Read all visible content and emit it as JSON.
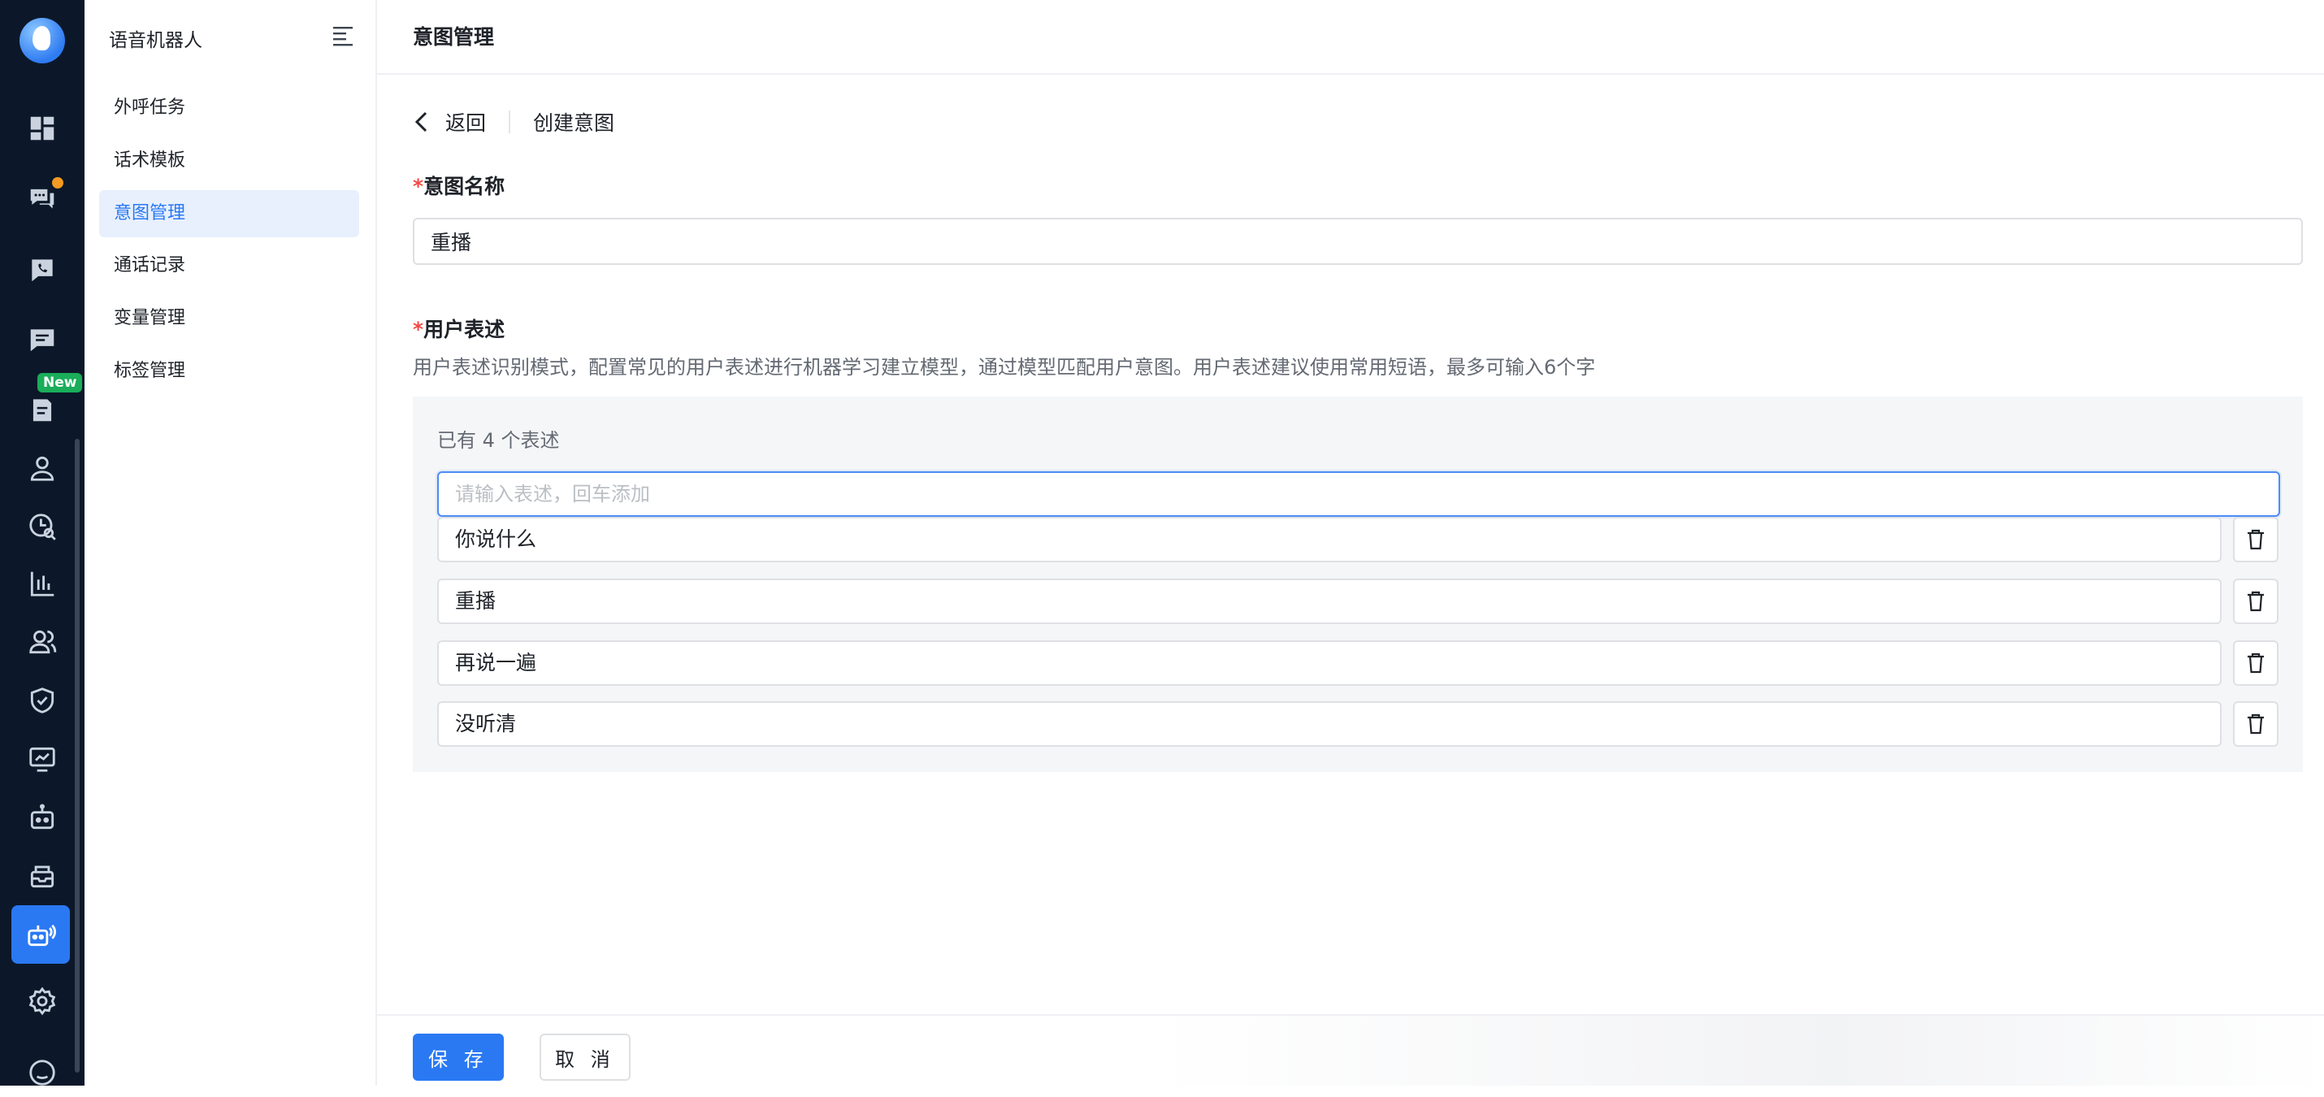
{
  "rail": {
    "icons": [
      "logo",
      "dashboard-icon",
      "chat-bubbles-icon",
      "phone-chat-icon",
      "message-icon",
      "document-icon",
      "user-icon",
      "clock-search-icon",
      "bar-chart-icon",
      "users-icon",
      "shield-check-icon",
      "monitor-chart-icon",
      "robot-icon",
      "inbox-icon",
      "voice-robot-icon",
      "settings-icon",
      "chat-circle-icon"
    ],
    "new_badge": "New",
    "notify_badge_color": "#f59a23",
    "active_color": "#2a79f3"
  },
  "menu": {
    "title": "语音机器人",
    "items": [
      {
        "label": "外呼任务"
      },
      {
        "label": "话术模板"
      },
      {
        "label": "意图管理"
      },
      {
        "label": "通话记录"
      },
      {
        "label": "变量管理"
      },
      {
        "label": "标签管理"
      }
    ]
  },
  "header": {
    "title": "意图管理"
  },
  "breadcrumb": {
    "back_label": "返回",
    "current": "创建意图"
  },
  "form": {
    "required_mark": "*",
    "intent_name_label": "意图名称",
    "intent_name_value": "重播",
    "user_expr_label": "用户表述",
    "user_expr_help": "用户表述识别模式，配置常见的用户表述进行机器学习建立模型，通过模型匹配用户意图。用户表述建议使用常用短语，最多可输入6个字",
    "expr_count_text": "已有 4 个表述",
    "expr_placeholder": "请输入表述，回车添加",
    "expressions": [
      "你说什么",
      "重播",
      "再说一遍",
      "没听清"
    ]
  },
  "footer": {
    "save_label": "保 存",
    "cancel_label": "取 消"
  }
}
